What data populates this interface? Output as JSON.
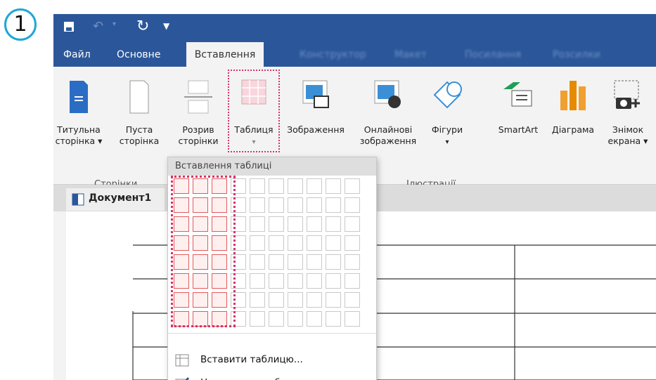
{
  "step_number": "1",
  "quick_access": {
    "save": "save-icon",
    "undo": "undo-icon",
    "redo": "redo-icon",
    "customize": "dropdown-arrow-icon"
  },
  "tabs": [
    {
      "label": "Файл",
      "active": false
    },
    {
      "label": "Основне",
      "active": false
    },
    {
      "label": "Вставлення",
      "active": true
    },
    {
      "label": "Конструктор",
      "active": false,
      "blurred": true
    },
    {
      "label": "Макет",
      "active": false,
      "blurred": true
    },
    {
      "label": "Посилання",
      "active": false,
      "blurred": true
    },
    {
      "label": "Розсилки",
      "active": false,
      "blurred": true
    }
  ],
  "ribbon": {
    "cover_page": {
      "line1": "Титульна",
      "line2": "сторінка ▾"
    },
    "blank_page": {
      "line1": "Пуста",
      "line2": "сторінка"
    },
    "page_break": {
      "line1": "Розрив",
      "line2": "сторінки"
    },
    "table": {
      "line1": "Таблиця",
      "line2": "▾"
    },
    "pictures": {
      "line1": "Зображення"
    },
    "online_pictures": {
      "line1": "Онлайнові",
      "line2": "зображення"
    },
    "shapes": {
      "line1": "Фігури",
      "line2": "▾"
    },
    "smartart": {
      "line1": "SmartArt"
    },
    "chart": {
      "line1": "Діаграма"
    },
    "screenshot": {
      "line1": "Знімок",
      "line2": "екрана ▾"
    },
    "groups": {
      "pages": "Сторінки",
      "illustrations": "Ілюстрації"
    }
  },
  "document": {
    "tab_title": "Документ1"
  },
  "dropdown": {
    "header": "Вставлення таблиці",
    "grid": {
      "cols": 10,
      "rows": 8,
      "selected_cols": 3,
      "selected_rows": 8
    },
    "items": [
      {
        "label": "Вставити таблицю...",
        "icon": "table-icon"
      },
      {
        "label": "Накреслити таблицю",
        "icon": "pencil-table-icon"
      }
    ]
  },
  "colors": {
    "ribbon_blue": "#2b579a",
    "highlight": "#d6336c",
    "accent_circle": "#1fa7d6"
  }
}
